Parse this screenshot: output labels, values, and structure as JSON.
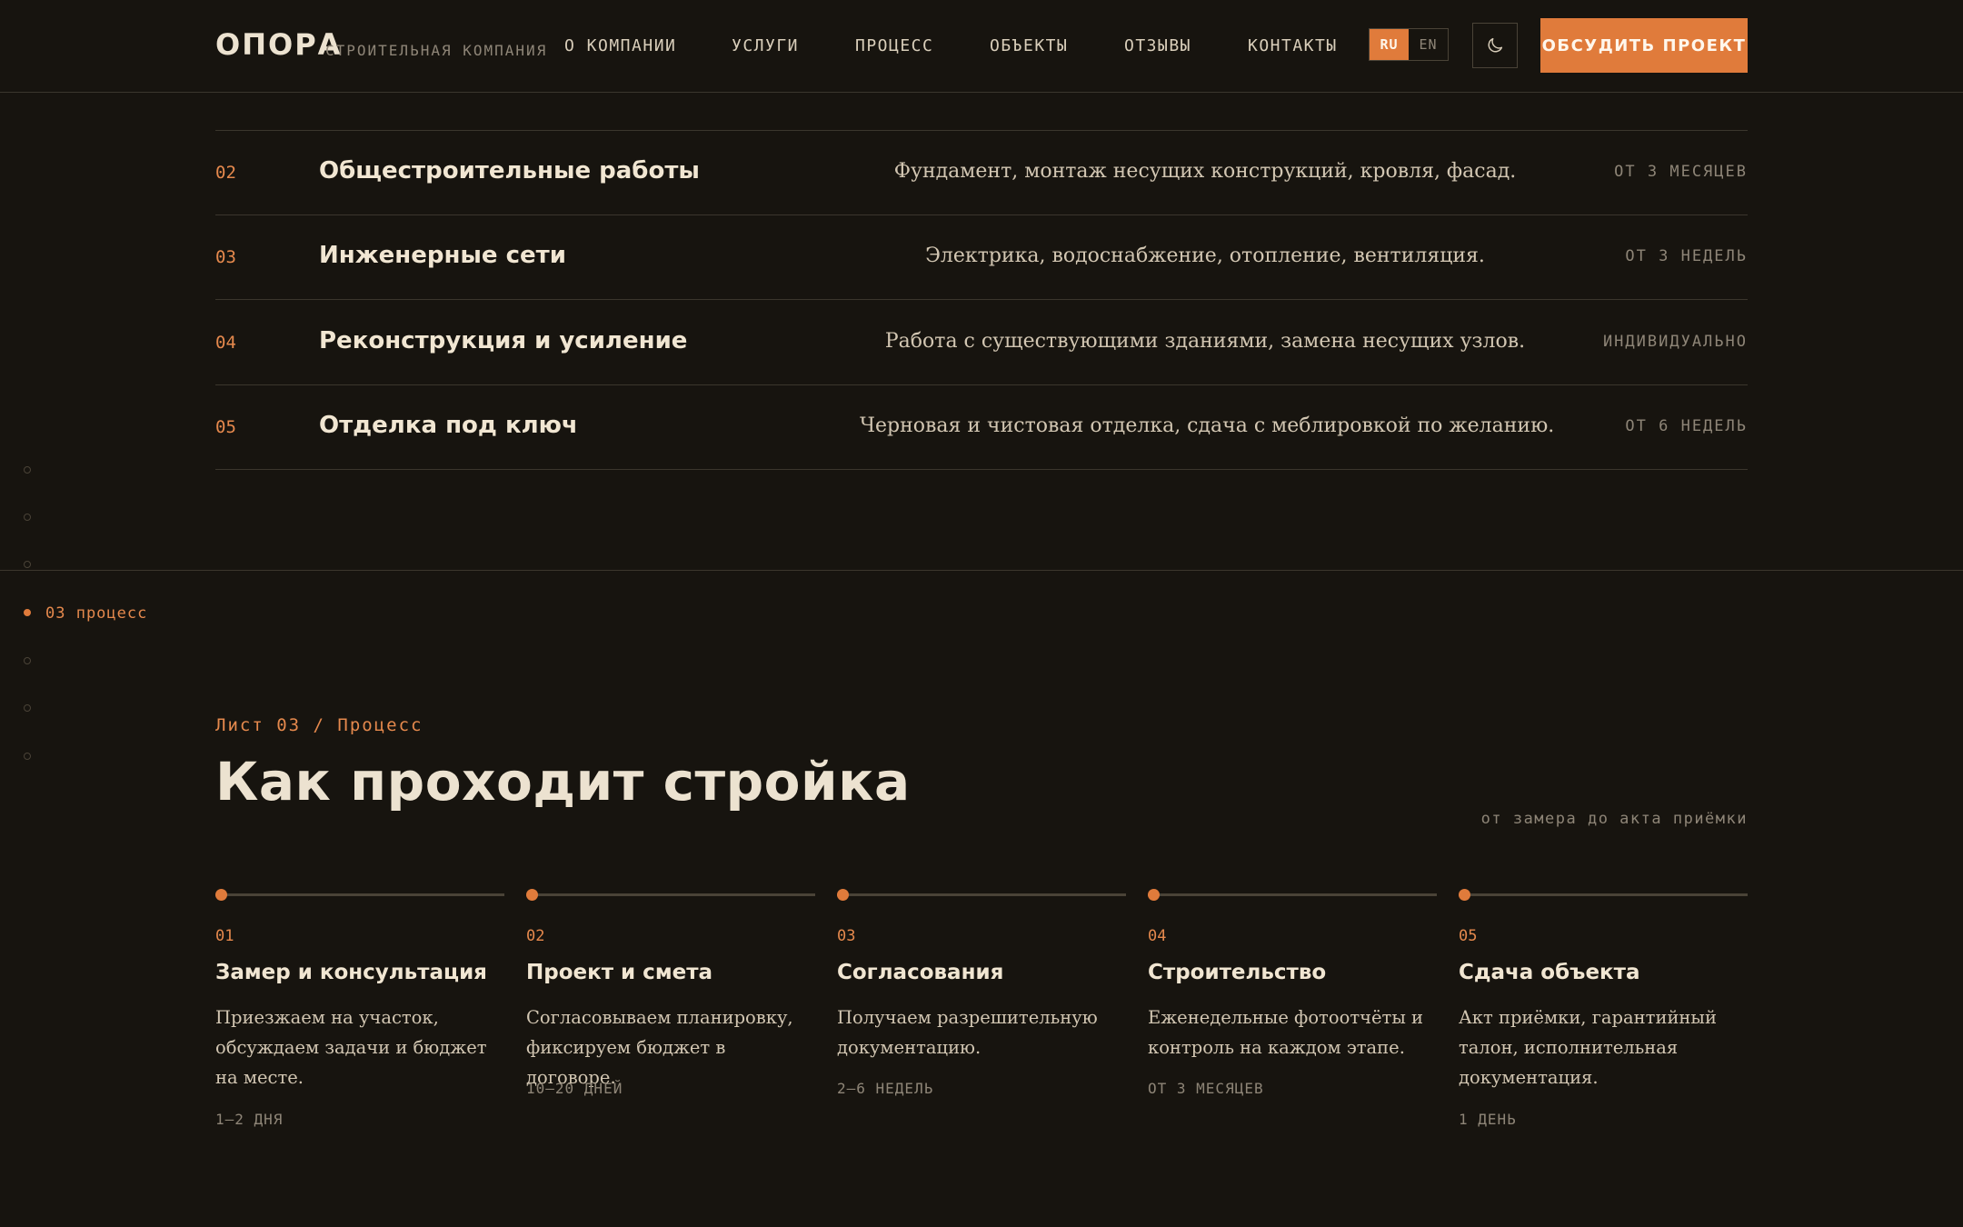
{
  "header": {
    "logo": "ОПОРА",
    "logo_subtitle": "СТРОИТЕЛЬНАЯ КОМПАНИЯ",
    "nav": [
      "О КОМПАНИИ",
      "УСЛУГИ",
      "ПРОЦЕСС",
      "ОБЪЕКТЫ",
      "ОТЗЫВЫ",
      "КОНТАКТЫ"
    ],
    "lang_active": "RU",
    "lang_inactive": "EN",
    "theme_icon": "moon-icon",
    "cta": "ОБСУДИТЬ ПРОЕКТ"
  },
  "services": {
    "rows": [
      {
        "num": "02",
        "title": "Общестроительные работы",
        "desc": "Фундамент, монтаж несущих конструкций, кровля, фасад.",
        "term": "ОТ 3 МЕСЯЦЕВ"
      },
      {
        "num": "03",
        "title": "Инженерные сети",
        "desc": "Электрика, водоснабжение, отопление, вентиляция.",
        "term": "ОТ 3 НЕДЕЛЬ"
      },
      {
        "num": "04",
        "title": "Реконструкция и усиление",
        "desc": "Работа с существующими зданиями, замена несущих узлов.",
        "term": "ИНДИВИДУАЛЬНО"
      },
      {
        "num": "05",
        "title": "Отделка под ключ",
        "desc": "Черновая и чистовая отделка, сдача с меблировкой по желанию.",
        "term": "ОТ 6 НЕДЕЛЬ"
      }
    ]
  },
  "side_nav": {
    "active_label": "03 процесс"
  },
  "process": {
    "eyebrow": "Лист 03 / Процесс",
    "title": "Как проходит стройка",
    "aside": "от замера до акта приёмки",
    "steps": [
      {
        "num": "01",
        "title": "Замер и консультация",
        "desc": "Приезжаем на участок, обсуждаем задачи и бюджет на месте.",
        "term": "1–2 ДНЯ"
      },
      {
        "num": "02",
        "title": "Проект и смета",
        "desc": "Согласовываем планировку, фиксируем бюджет в договоре.",
        "term": "10–20 ДНЕЙ"
      },
      {
        "num": "03",
        "title": "Согласования",
        "desc": "Получаем разрешительную документацию.",
        "term": "2–6 НЕДЕЛЬ"
      },
      {
        "num": "04",
        "title": "Строительство",
        "desc": "Еженедельные фотоотчёты и контроль на каждом этапе.",
        "term": "ОТ 3 МЕСЯЦЕВ"
      },
      {
        "num": "05",
        "title": "Сдача объекта",
        "desc": "Акт приёмки, гарантийный талон, исполнительная документация.",
        "term": "1 ДЕНЬ"
      }
    ]
  },
  "colors": {
    "background": "#17140f",
    "accent": "#e07b3b",
    "text": "#ece2d0",
    "muted": "#8e8577"
  }
}
